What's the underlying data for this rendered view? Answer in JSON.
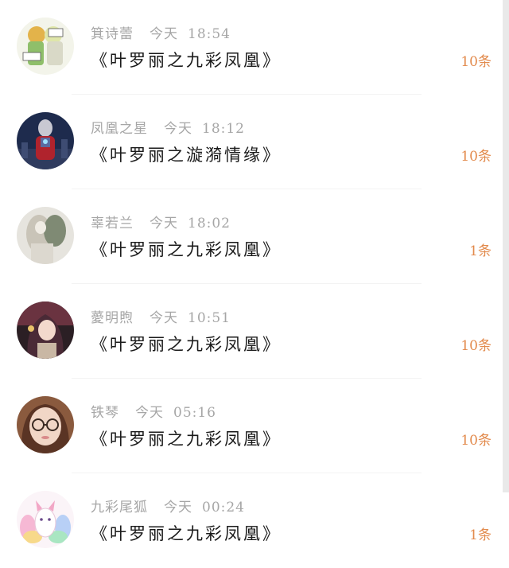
{
  "rows": [
    {
      "name": "箕诗蕾",
      "day": "今天",
      "time": "18:54",
      "title": "《叶罗丽之九彩凤凰》",
      "count": "10条",
      "avatar_icon": "anime-duo-avatar"
    },
    {
      "name": "凤凰之星",
      "day": "今天",
      "time": "18:12",
      "title": "《叶罗丽之漩漪情缘》",
      "count": "10条",
      "avatar_icon": "ultraman-avatar"
    },
    {
      "name": "辜若兰",
      "day": "今天",
      "time": "18:02",
      "title": "《叶罗丽之九彩凤凰》",
      "count": "1条",
      "avatar_icon": "faded-portrait-avatar"
    },
    {
      "name": "薆明煦",
      "day": "今天",
      "time": "10:51",
      "title": "《叶罗丽之九彩凤凰》",
      "count": "10条",
      "avatar_icon": "anime-girl-avatar"
    },
    {
      "name": "铁琴",
      "day": "今天",
      "time": "05:16",
      "title": "《叶罗丽之九彩凤凰》",
      "count": "10条",
      "avatar_icon": "glasses-girl-avatar"
    },
    {
      "name": "九彩尾狐",
      "day": "今天",
      "time": "00:24",
      "title": "《叶罗丽之九彩凤凰》",
      "count": "1条",
      "avatar_icon": "nine-tail-fox-avatar"
    }
  ],
  "colors": {
    "meta": "#a6a6a6",
    "title": "#1a1a1a",
    "count": "#e28a4c"
  }
}
